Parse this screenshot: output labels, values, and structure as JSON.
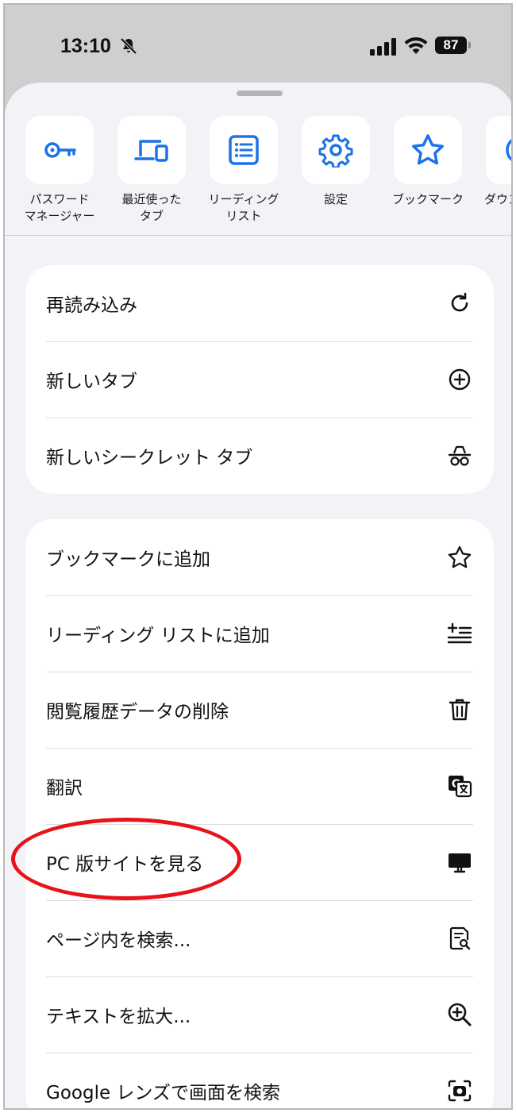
{
  "status_bar": {
    "time": "13:10",
    "battery": "87"
  },
  "quick_actions": [
    {
      "label": "パスワード\nマネージャー",
      "icon": "key-icon"
    },
    {
      "label": "最近使った\nタブ",
      "icon": "devices-icon"
    },
    {
      "label": "リーディング\nリスト",
      "icon": "reading-list-icon"
    },
    {
      "label": "設定",
      "icon": "gear-icon"
    },
    {
      "label": "ブックマーク",
      "icon": "star-icon"
    },
    {
      "label": "ダウンロード",
      "icon": "download-icon"
    }
  ],
  "menu_group_1": [
    {
      "label": "再読み込み",
      "icon": "reload-icon"
    },
    {
      "label": "新しいタブ",
      "icon": "plus-circle-icon"
    },
    {
      "label": "新しいシークレット タブ",
      "icon": "incognito-icon"
    }
  ],
  "menu_group_2": [
    {
      "label": "ブックマークに追加",
      "icon": "star-outline-icon"
    },
    {
      "label": "リーディング リストに追加",
      "icon": "add-to-list-icon"
    },
    {
      "label": "閲覧履歴データの削除",
      "icon": "trash-icon"
    },
    {
      "label": "翻訳",
      "icon": "translate-icon"
    },
    {
      "label": "PC 版サイトを見る",
      "icon": "desktop-icon"
    },
    {
      "label": "ページ内を検索...",
      "icon": "find-in-page-icon"
    },
    {
      "label": "テキストを拡大...",
      "icon": "zoom-in-icon"
    },
    {
      "label": "Google レンズで画面を検索",
      "icon": "lens-icon"
    }
  ],
  "colors": {
    "accent": "#1a73e8",
    "highlight": "#e8131a",
    "sheet_bg": "#f2f2f7"
  }
}
